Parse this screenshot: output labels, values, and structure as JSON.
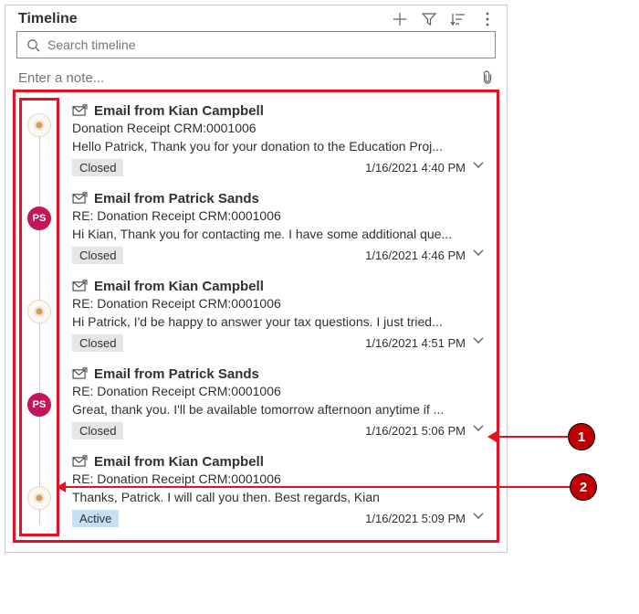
{
  "header": {
    "title": "Timeline"
  },
  "search": {
    "placeholder": "Search timeline",
    "value": ""
  },
  "note": {
    "placeholder": "Enter a note..."
  },
  "callouts": {
    "one": "1",
    "two": "2"
  },
  "rail": [
    {
      "kind": "logo",
      "initials": ""
    },
    {
      "kind": "ps",
      "initials": "PS"
    },
    {
      "kind": "logo",
      "initials": ""
    },
    {
      "kind": "ps",
      "initials": "PS"
    },
    {
      "kind": "logo",
      "initials": ""
    }
  ],
  "items": [
    {
      "title": "Email from Kian Campbell",
      "subject": "Donation Receipt CRM:0001006",
      "preview": "Hello Patrick,   Thank you for your donation to the Education Proj...",
      "status": "Closed",
      "status_kind": "closed",
      "timestamp": "1/16/2021 4:40 PM"
    },
    {
      "title": "Email from Patrick Sands",
      "subject": "RE: Donation Receipt CRM:0001006",
      "preview": "Hi Kian, Thank you for contacting me. I have some additional que...",
      "status": "Closed",
      "status_kind": "closed",
      "timestamp": "1/16/2021 4:46 PM"
    },
    {
      "title": "Email from Kian Campbell",
      "subject": "RE: Donation Receipt CRM:0001006",
      "preview": "Hi Patrick,   I'd be happy to answer your tax questions. I just tried...",
      "status": "Closed",
      "status_kind": "closed",
      "timestamp": "1/16/2021 4:51 PM"
    },
    {
      "title": "Email from Patrick Sands",
      "subject": "RE: Donation Receipt CRM:0001006",
      "preview": "Great, thank you. I'll be available tomorrow afternoon anytime if ...",
      "status": "Closed",
      "status_kind": "closed",
      "timestamp": "1/16/2021 5:06 PM"
    },
    {
      "title": "Email from Kian Campbell",
      "subject": "RE: Donation Receipt CRM:0001006",
      "preview": "Thanks, Patrick. I will call you then.   Best regards, Kian",
      "status": "Active",
      "status_kind": "active",
      "timestamp": "1/16/2021 5:09 PM"
    }
  ]
}
